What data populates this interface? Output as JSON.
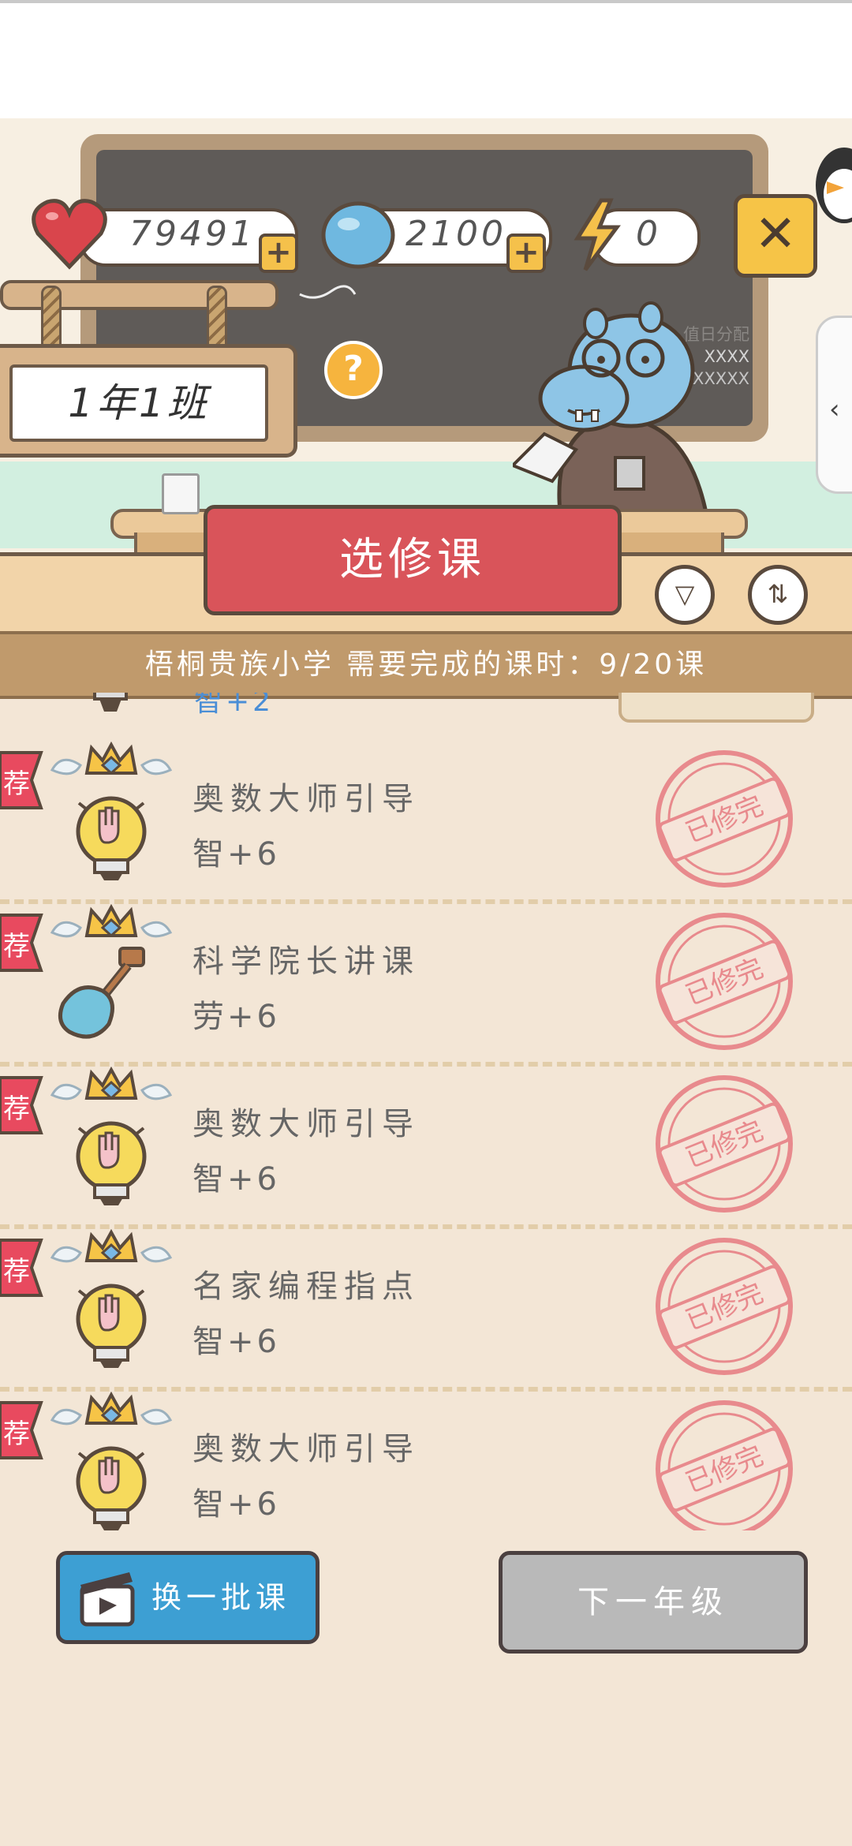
{
  "header": {
    "hearts": "79491",
    "coins": "2100",
    "energy": "0",
    "close_icon": "close-icon"
  },
  "board": {
    "duty_title": "值日分配",
    "duty_line1": "XXXX",
    "duty_line2": "XXXXXX"
  },
  "class_sign": {
    "label": "1年1班"
  },
  "help_label": "?",
  "title": "选修课",
  "info_bar": "梧桐贵族小学  需要完成的课时：9/20课",
  "partial_stat": "智+2",
  "tag_label": "荐",
  "stamp_text": "已修完",
  "courses": [
    {
      "name": "奥数大师引导",
      "stat": "智+6",
      "icon": "lightbulb-icon"
    },
    {
      "name": "科学院长讲课",
      "stat": "劳+6",
      "icon": "shovel-icon"
    },
    {
      "name": "奥数大师引导",
      "stat": "智+6",
      "icon": "lightbulb-icon"
    },
    {
      "name": "名家编程指点",
      "stat": "智+6",
      "icon": "lightbulb-icon"
    },
    {
      "name": "奥数大师引导",
      "stat": "智+6",
      "icon": "lightbulb-icon"
    }
  ],
  "buttons": {
    "swap": "换一批课",
    "next_grade": "下一年级"
  },
  "colors": {
    "background": "#f3e6d6",
    "title_banner": "#d9545a",
    "info_bar": "#c09a6c",
    "swap_button": "#3d9fd3",
    "next_button": "#b9b9b9",
    "stamp": "#e88a8d"
  }
}
